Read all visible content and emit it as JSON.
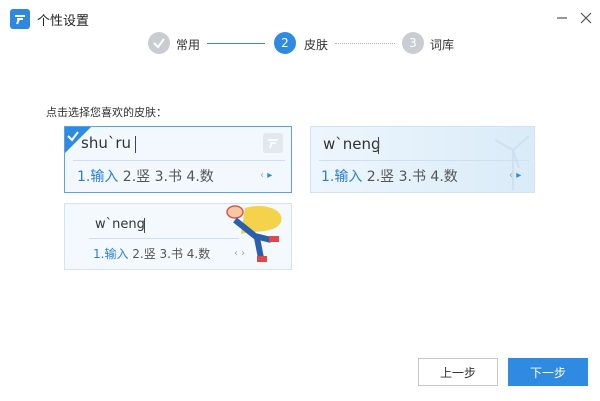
{
  "window": {
    "title": "个性设置",
    "minimize_label": "",
    "close_label": ""
  },
  "steps": [
    {
      "number": "1",
      "label": "常用",
      "state": "done"
    },
    {
      "number": "2",
      "label": "皮肤",
      "state": "current"
    },
    {
      "number": "3",
      "label": "词库",
      "state": "pending"
    }
  ],
  "instruction": "点击选择您喜欢的皮肤：",
  "skins": [
    {
      "composition": "shu`ru",
      "candidates_first": "1.输入",
      "candidates_rest": " 2.竖 3.书 4.数",
      "selected": true
    },
    {
      "composition": "w`neng",
      "candidates_first": "1.输入",
      "candidates_rest": " 2.竖 3.书 4.数",
      "selected": false
    },
    {
      "composition": "w`neng",
      "candidates_first": "1.输入",
      "candidates_rest": " 2.竖 3.书 4.数",
      "selected": false
    }
  ],
  "buttons": {
    "prev": "上一步",
    "next": "下一步"
  },
  "colors": {
    "accent": "#2f8ae2",
    "step_done": "#c9cdd2",
    "step_pending": "#c9cdd2",
    "border_selected": "#57a3e6"
  }
}
